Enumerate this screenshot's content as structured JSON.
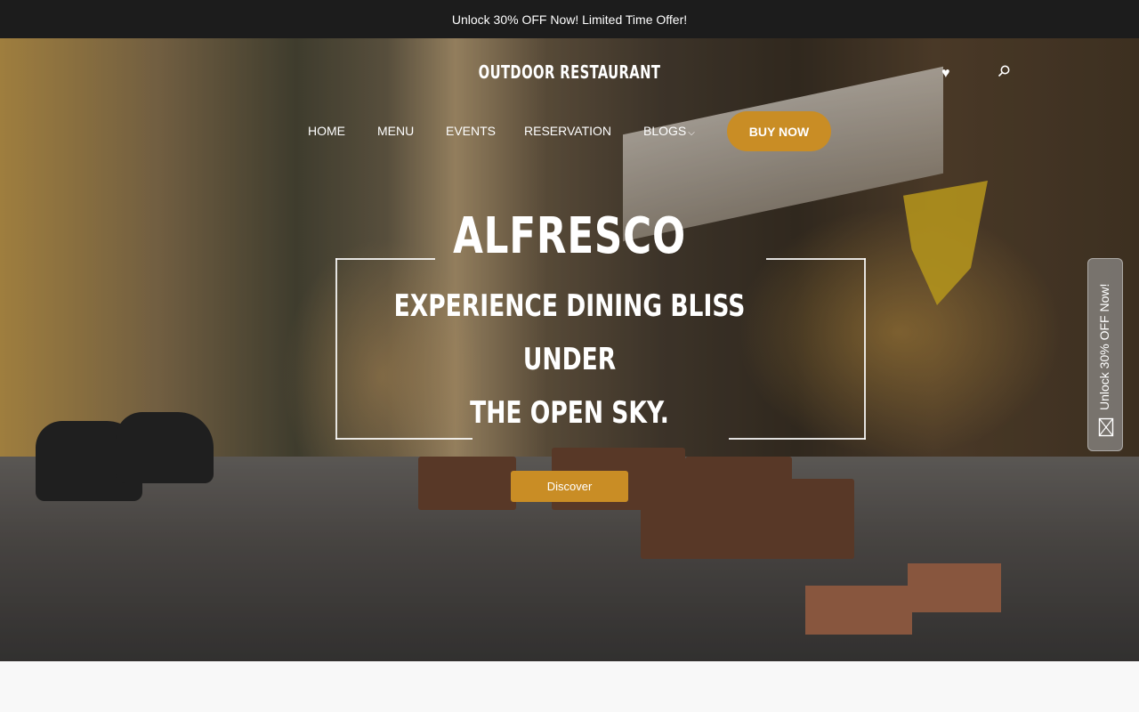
{
  "announcement": "Unlock 30% OFF Now! Limited Time Offer!",
  "header": {
    "logo": "OUTDOOR RESTAURANT",
    "icons": [
      "heart-icon",
      "search-icon"
    ]
  },
  "nav": {
    "items": [
      "HOME",
      "MENU",
      "EVENTS",
      "RESERVATION",
      "BLOGS"
    ],
    "blogs_chevron": "⌵",
    "cta": "BUY NOW"
  },
  "hero": {
    "title": "ALFRESCO",
    "subtitle_lines": [
      "EXPERIENCE DINING BLISS",
      "UNDER",
      "THE OPEN SKY."
    ],
    "button": "Discover"
  },
  "side_tab": {
    "label": "Unlock 30% OFF Now!",
    "icon": "gift-icon"
  },
  "colors": {
    "accent": "#c98d25",
    "topbar": "#1c1c1c"
  }
}
